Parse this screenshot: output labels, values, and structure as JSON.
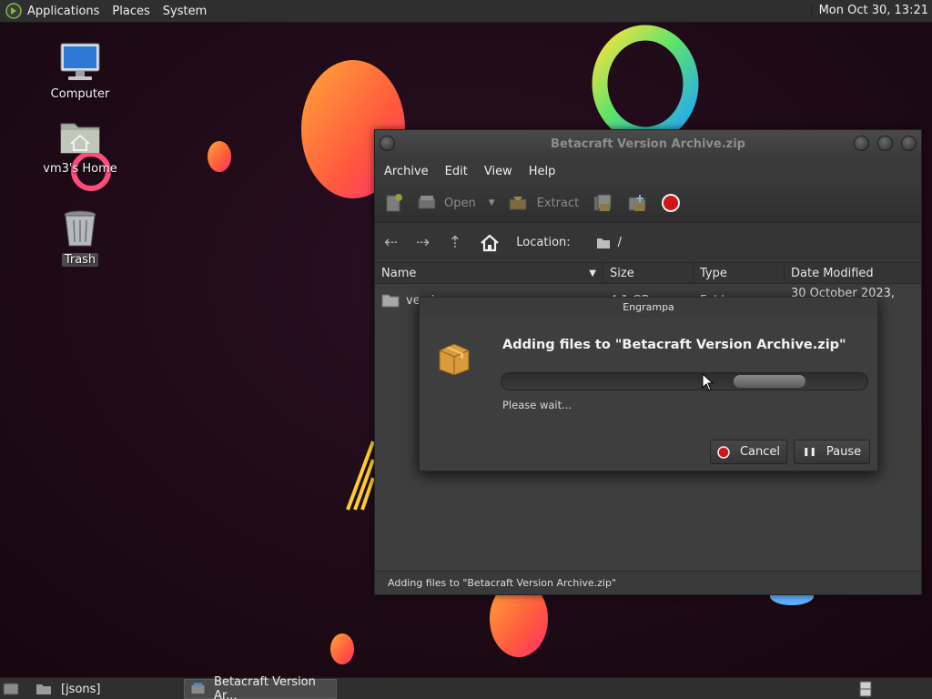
{
  "top_panel": {
    "menus": [
      "Applications",
      "Places",
      "System"
    ],
    "clock": "Mon Oct 30, 13:21"
  },
  "desktop": {
    "icons": [
      {
        "label": "Computer",
        "icon": "computer-icon"
      },
      {
        "label": "vm3's Home",
        "icon": "home-folder-icon"
      },
      {
        "label": "Trash",
        "icon": "trash-icon"
      }
    ]
  },
  "window": {
    "title": "Betacraft Version Archive.zip",
    "menubar": [
      "Archive",
      "Edit",
      "View",
      "Help"
    ],
    "toolbar": {
      "open_label": "Open",
      "extract_label": "Extract"
    },
    "location_label": "Location:",
    "location_path": "/",
    "columns": [
      "Name",
      "Size",
      "Type",
      "Date Modified"
    ],
    "rows": [
      {
        "name": "versions",
        "size": "4.1 GB",
        "type": "Folder",
        "date": "30 October 2023, 12:52"
      }
    ],
    "status": "Adding files to \"Betacraft Version Archive.zip\""
  },
  "dialog": {
    "title": "Engrampa",
    "heading": "Adding files to \"Betacraft Version Archive.zip\"",
    "message": "Please wait...",
    "cancel_label": "Cancel",
    "pause_label": "Pause"
  },
  "taskbar": {
    "tasks": [
      "[jsons]",
      "Betacraft Version Ar..."
    ]
  },
  "colors": {
    "desktop_bg": "#1e0b19",
    "panel_bg": "#2f2f2f",
    "window_bg": "#3c3c3c",
    "stop_red": "#d0151b"
  }
}
